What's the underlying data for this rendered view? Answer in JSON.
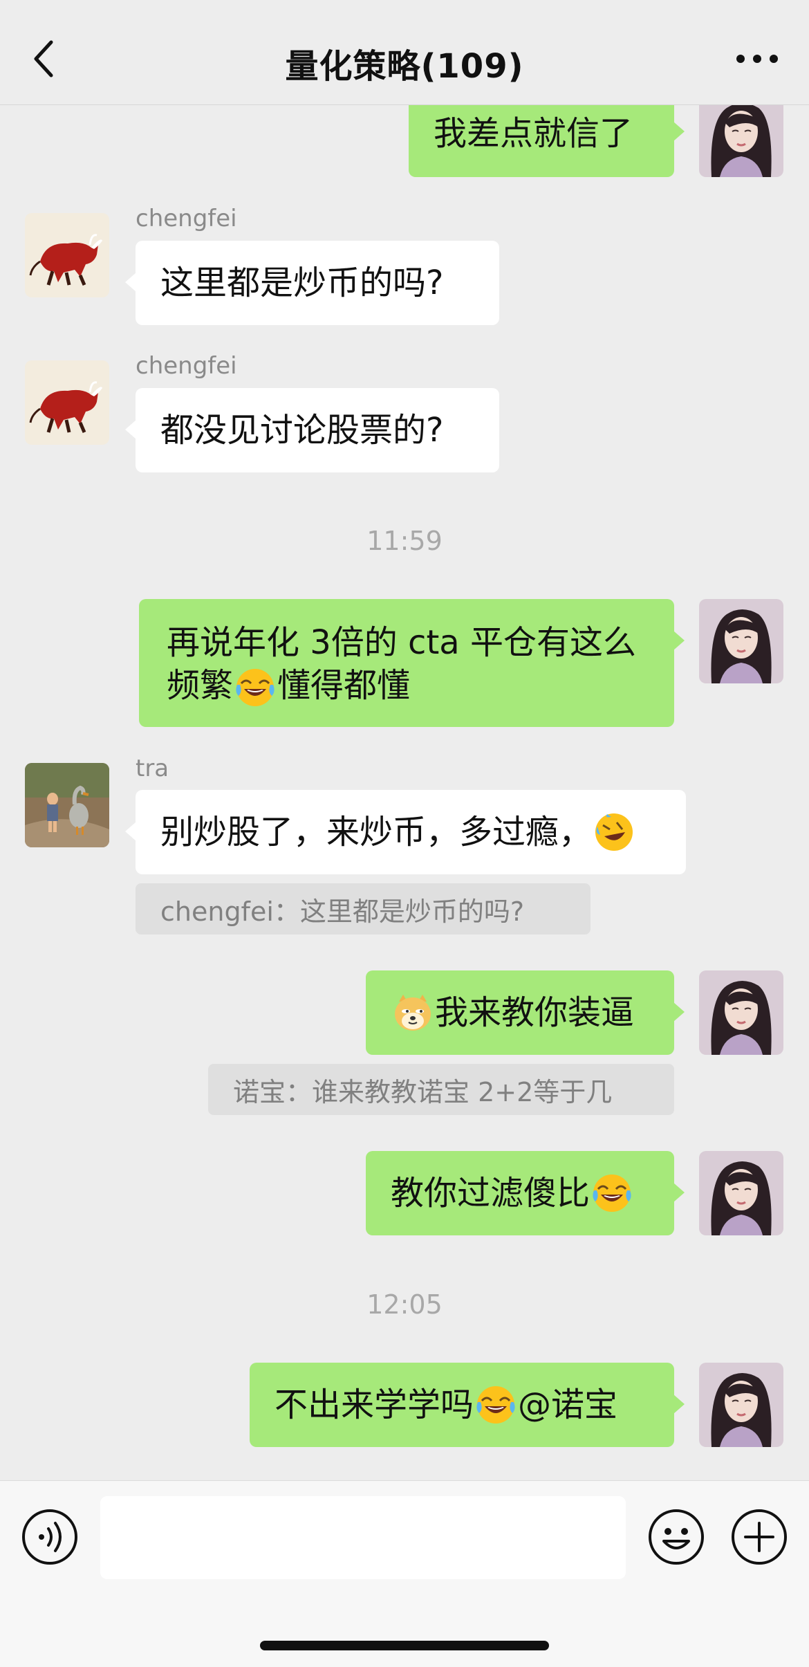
{
  "header": {
    "title": "量化策略(109)"
  },
  "messages": {
    "m1": {
      "text": "我差点就信了"
    },
    "m2": {
      "sender": "chengfei",
      "text": "这里都是炒币的吗?"
    },
    "m3": {
      "sender": "chengfei",
      "text": "都没见讨论股票的?"
    },
    "t1": "11:59",
    "m4": {
      "line1": "再说年化 3倍的 cta 平仓有这么",
      "line2a": "频繁",
      "line2b": "懂得都懂"
    },
    "m5": {
      "sender": "tra",
      "text": "别炒股了，来炒币，多过瘾，",
      "quote": "chengfei：这里都是炒币的吗?"
    },
    "m6": {
      "text": "我来教你装逼",
      "quote": "诺宝：谁来教教诺宝 2+2等于几"
    },
    "m7": {
      "text": "教你过滤傻比"
    },
    "t2": "12:05",
    "m8": {
      "text_a": "不出来学学吗",
      "text_b": "@诺宝"
    }
  },
  "input": {
    "value": "",
    "placeholder": ""
  },
  "icons": {
    "back": "chevron-left-icon",
    "more": "more-dots-icon",
    "voice": "voice-icon",
    "emoji": "emoji-face-icon",
    "plus": "plus-icon",
    "laugh_cry": "face-with-tears-of-joy-icon",
    "cry_laugh": "rolling-laughing-crying-icon",
    "doge": "doge-dog-icon"
  },
  "colors": {
    "bubble_green": "#a6e97a",
    "background": "#ededed",
    "bubble_white": "#ffffff"
  }
}
